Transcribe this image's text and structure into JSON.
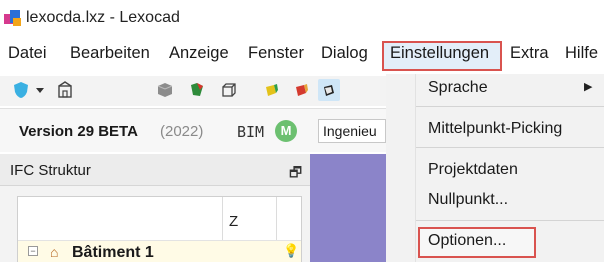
{
  "window": {
    "title": "lexocda.lxz - Lexocad"
  },
  "menubar": {
    "items": [
      "Datei",
      "Bearbeiten",
      "Anzeige",
      "Fenster",
      "Dialog",
      "Einstellungen",
      "Extra",
      "Hilfe"
    ]
  },
  "versionbar": {
    "version": "Version 29 BETA",
    "year": "(2022)",
    "bim_label": "BIM",
    "bim_badge": "M",
    "engineer_value": "Ingenieu"
  },
  "ifc_panel": {
    "title": "IFC Struktur",
    "pin_icon": "pin-icon",
    "column_z": "Z",
    "tree": [
      {
        "expander": "⊟",
        "label": "Bâtiment 1"
      }
    ]
  },
  "dropdown": {
    "sprache": "Sprache",
    "mittelpunkt": "Mittelpunkt-Picking",
    "projektdaten": "Projektdaten",
    "nullpunkt": "Nullpunkt...",
    "optionen": "Optionen..."
  },
  "colors": {
    "highlight_border": "#d9534f",
    "menu_selected_bg": "#e3eef9",
    "viewport": "#8b84c9",
    "bim_badge": "#6cc070"
  }
}
